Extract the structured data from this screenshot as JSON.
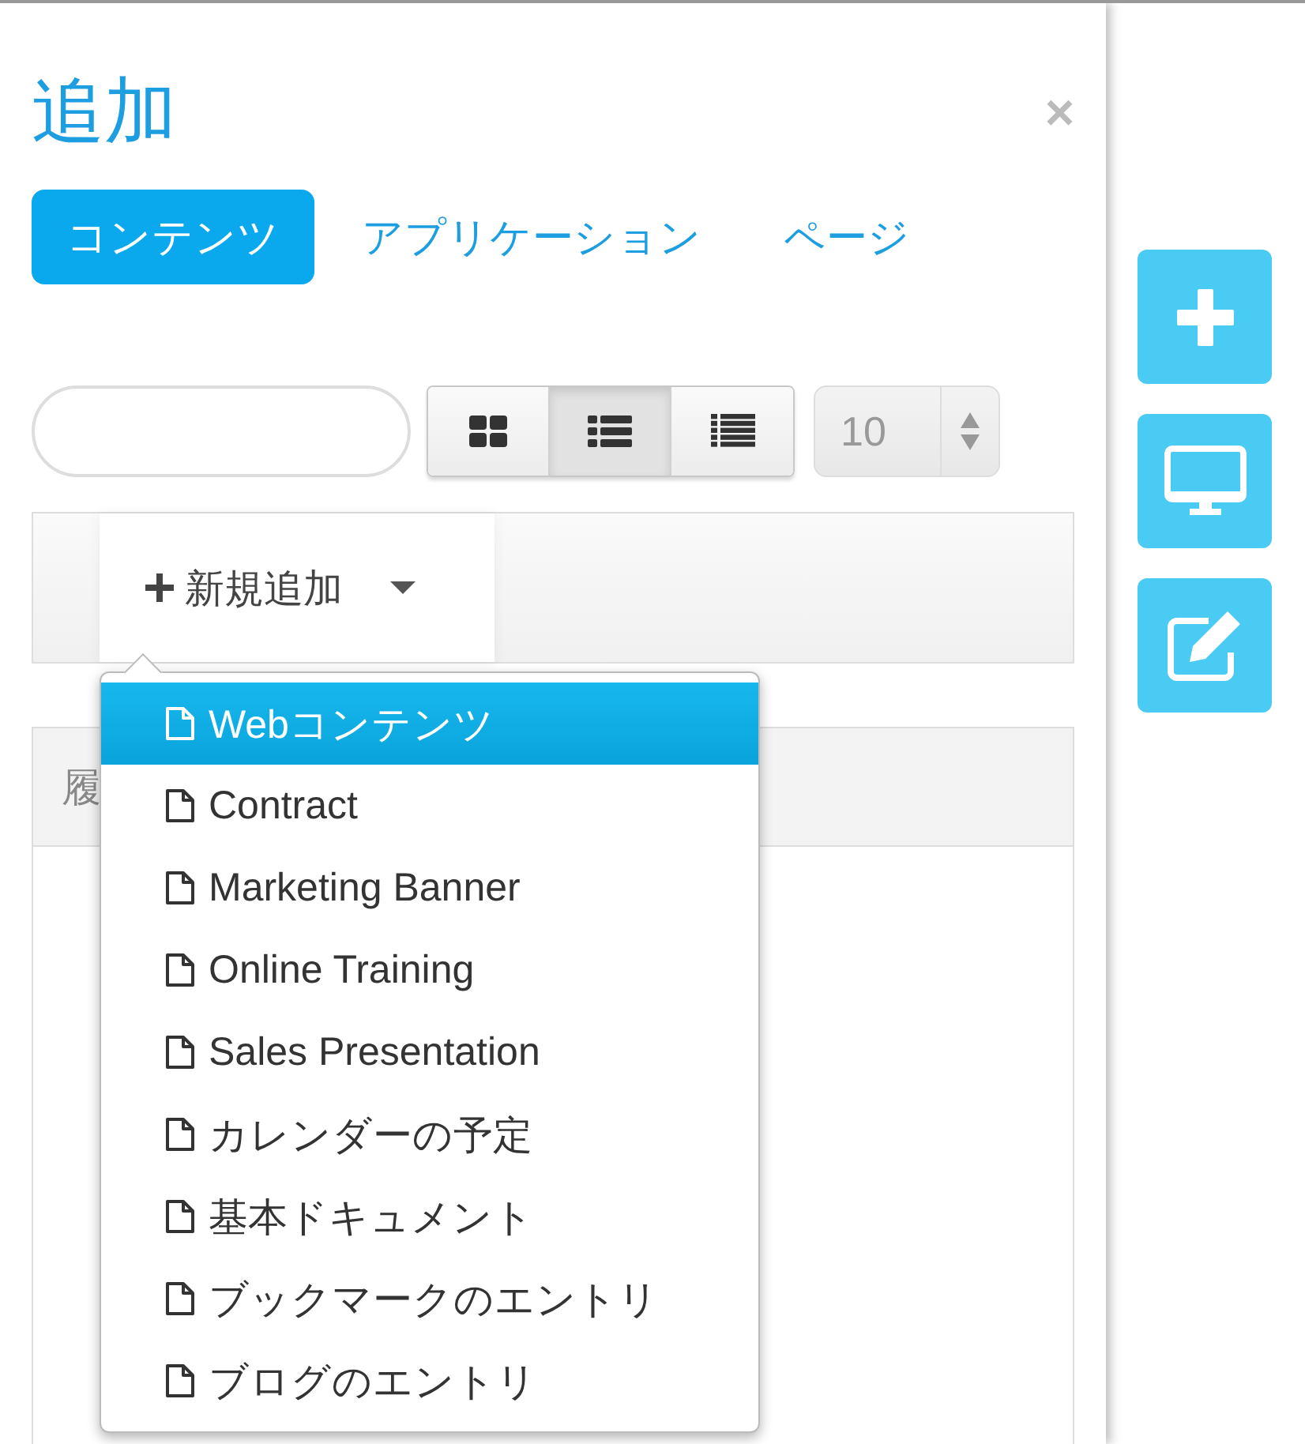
{
  "title": "追加",
  "close": "×",
  "tabs": [
    {
      "label": "コンテンツ",
      "selected": true
    },
    {
      "label": "アプリケーション",
      "selected": false
    },
    {
      "label": "ページ",
      "selected": false
    }
  ],
  "view_buttons": [
    {
      "kind": "icons",
      "selected": false
    },
    {
      "kind": "descriptive",
      "selected": true
    },
    {
      "kind": "list",
      "selected": false
    }
  ],
  "page_size": "10",
  "add_button": {
    "label": "新規追加",
    "expanded": true
  },
  "menu": [
    {
      "label": "Webコンテンツ",
      "selected": true
    },
    {
      "label": "Contract",
      "selected": false
    },
    {
      "label": "Marketing Banner",
      "selected": false
    },
    {
      "label": "Online Training",
      "selected": false
    },
    {
      "label": "Sales Presentation",
      "selected": false
    },
    {
      "label": "カレンダーの予定",
      "selected": false
    },
    {
      "label": "基本ドキュメント",
      "selected": false
    },
    {
      "label": "ブックマークのエントリ",
      "selected": false
    },
    {
      "label": "ブログのエントリ",
      "selected": false
    }
  ],
  "panel_heading": "履",
  "side_buttons": [
    {
      "kind": "add"
    },
    {
      "kind": "preview"
    },
    {
      "kind": "edit"
    }
  ]
}
